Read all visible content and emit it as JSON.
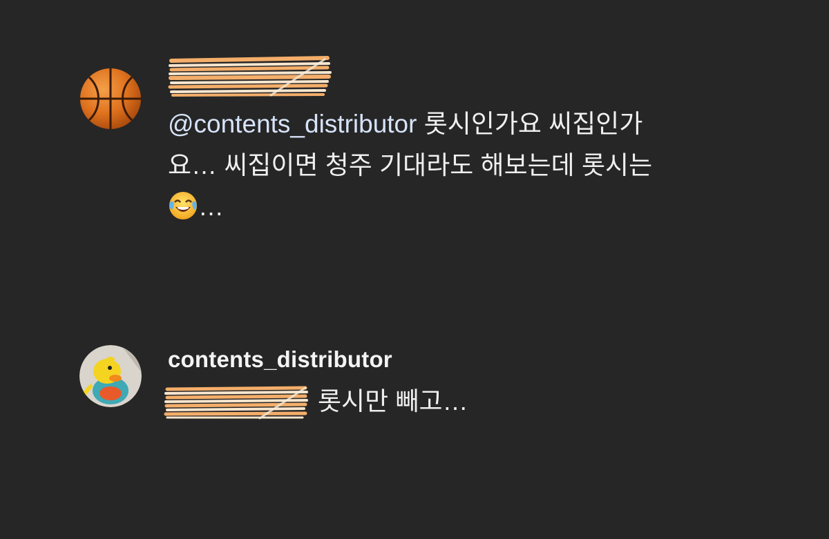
{
  "comments": [
    {
      "avatar_icon": "basketball-icon",
      "username_redacted": true,
      "mention": "@contents_distributor",
      "text_line1": " 롯시인가요 씨집인가",
      "text_line2": "요… 씨집이면 청주 기대라도 해보는데 롯시는",
      "emoji_icon": "face-with-tears-of-joy-icon",
      "text_line3_tail": "…"
    },
    {
      "avatar_icon": "duck-avatar-icon",
      "username": "contents_distributor",
      "mention_redacted": true,
      "text": "롯시만 빼고…"
    }
  ],
  "colors": {
    "background": "#262626",
    "text": "#efefef",
    "mention": "#d7e3f8",
    "redaction_orange": "#f4ae6a",
    "redaction_cream": "#f8e6cf"
  }
}
